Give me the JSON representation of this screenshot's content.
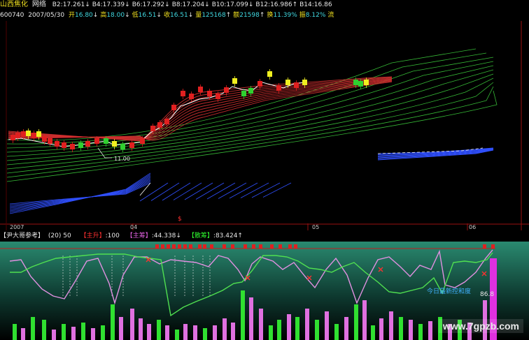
{
  "header": {
    "stock_name": "山西焦化",
    "tag": "网络",
    "ma_items": [
      {
        "label": "B2:",
        "value": "17.261",
        "arrow": "↓"
      },
      {
        "label": "B4:",
        "value": "17.339",
        "arrow": "↓"
      },
      {
        "label": "B6:",
        "value": "17.292",
        "arrow": "↓"
      },
      {
        "label": "B8:",
        "value": "17.204",
        "arrow": "↓"
      },
      {
        "label": "B10:",
        "value": "17.099",
        "arrow": "↓"
      },
      {
        "label": "B12:",
        "value": "16.986",
        "arrow": "↑"
      },
      {
        "label": "B14:",
        "value": "16.86",
        "arrow": ""
      }
    ],
    "code": "600740",
    "date": "2007/05/30",
    "quote": [
      {
        "label": "开",
        "value": "16.80",
        "arrow": "↓"
      },
      {
        "label": "高",
        "value": "18.00",
        "arrow": "↓"
      },
      {
        "label": "低",
        "value": "16.51",
        "arrow": "↓"
      },
      {
        "label": "收",
        "value": "16.51",
        "arrow": "↓"
      },
      {
        "label": "量",
        "value": "125168",
        "arrow": "↑"
      },
      {
        "label": "额",
        "value": "21598",
        "arrow": "↑"
      },
      {
        "label": "换",
        "value": "11.39%",
        "arrow": ""
      },
      {
        "label": "振",
        "value": "8.12%",
        "arrow": ""
      },
      {
        "label": "流",
        "value": "",
        "arrow": ""
      }
    ]
  },
  "main_chart": {
    "price_label": "11.00",
    "axis_labels": [
      "2007",
      "04",
      "05",
      "06"
    ],
    "marker": "$",
    "colors": {
      "price": "#ffffff",
      "ribbon_red": "#d23030",
      "ribbon_green": "#40d840",
      "ribbon_blue": "#3050ff",
      "candle_up": "#e02020",
      "candle_down": "#30d030",
      "candle_hi": "#f0f020"
    }
  },
  "indicator": {
    "title": "【尹大哥参考】",
    "params": "(20) 50",
    "items": [
      {
        "name": "【主升】",
        "value": ":100",
        "color_class": "r"
      },
      {
        "name": "【主筹】",
        "value": ":44.338↓",
        "color_class": "m"
      },
      {
        "name": "【散筹】",
        "value": ":83.424↑",
        "color_class": "g"
      }
    ],
    "today_label": "今日最新控和度",
    "today_value": "86.8",
    "colors": {
      "background_top": "#2a8a70",
      "background_bottom": "#000000",
      "line_main": "#e090e0",
      "line_retail": "#50e050",
      "bar_green": "#30e030",
      "bar_pink": "#e070e0"
    }
  },
  "watermark": "www.7gpzb.com"
}
